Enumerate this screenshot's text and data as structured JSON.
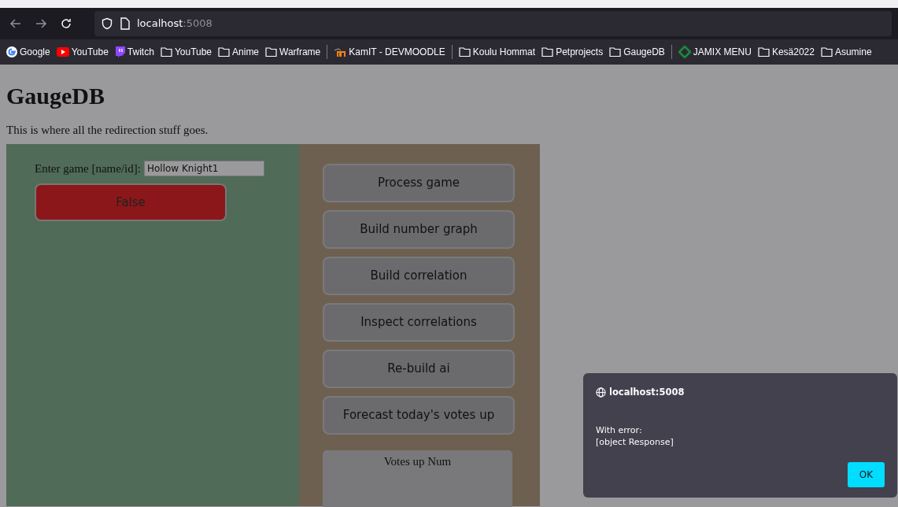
{
  "browser": {
    "url_host": "localhost",
    "url_port": ":5008",
    "bookmarks": [
      {
        "kind": "google",
        "label": "Google"
      },
      {
        "kind": "youtube",
        "label": "YouTube"
      },
      {
        "kind": "twitch",
        "label": "Twitch"
      },
      {
        "kind": "folder",
        "label": "YouTube"
      },
      {
        "kind": "folder",
        "label": "Anime"
      },
      {
        "kind": "folder",
        "label": "Warframe"
      },
      {
        "kind": "separator"
      },
      {
        "kind": "moodle",
        "label": "KamIT - DEVMOODLE"
      },
      {
        "kind": "separator"
      },
      {
        "kind": "folder",
        "label": "Koulu Hommat"
      },
      {
        "kind": "folder",
        "label": "Petprojects"
      },
      {
        "kind": "folder",
        "label": "GaugeDB"
      },
      {
        "kind": "separator"
      },
      {
        "kind": "jamix",
        "label": "JAMIX MENU"
      },
      {
        "kind": "folder",
        "label": "Kesä2022"
      },
      {
        "kind": "folder",
        "label": "Asumine"
      }
    ]
  },
  "page": {
    "title": "GaugeDB",
    "intro": "This is where all the redirection stuff goes.",
    "game_field": {
      "label": "Enter game [name/id]:",
      "value": "Hollow Knight1"
    },
    "result_button": "False",
    "actions": [
      "Process game",
      "Build number graph",
      "Build correlation",
      "Inspect correlations",
      "Re-build ai",
      "Forecast today's votes up"
    ],
    "votes_box": {
      "title": "Votes up Num"
    }
  },
  "dialog": {
    "origin": "localhost:5008",
    "message_lines": [
      "With error:",
      "[object Response]"
    ],
    "ok": "OK"
  }
}
